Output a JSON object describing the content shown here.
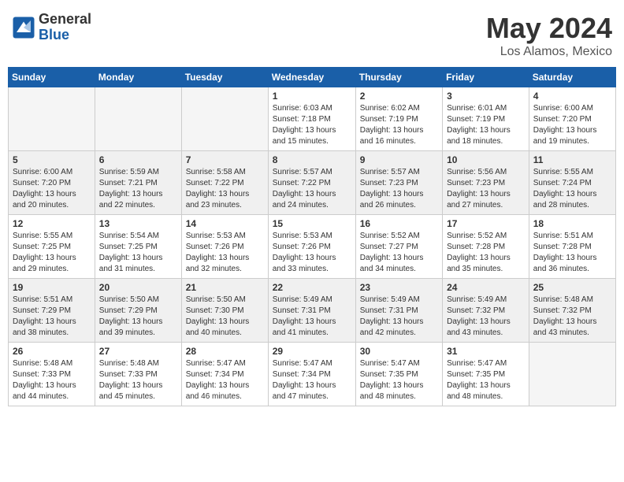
{
  "header": {
    "logo": {
      "general": "General",
      "blue": "Blue"
    },
    "title": "May 2024",
    "location": "Los Alamos, Mexico"
  },
  "weekdays": [
    "Sunday",
    "Monday",
    "Tuesday",
    "Wednesday",
    "Thursday",
    "Friday",
    "Saturday"
  ],
  "weeks": [
    [
      {
        "day": "",
        "sunrise": "",
        "sunset": "",
        "daylight": ""
      },
      {
        "day": "",
        "sunrise": "",
        "sunset": "",
        "daylight": ""
      },
      {
        "day": "",
        "sunrise": "",
        "sunset": "",
        "daylight": ""
      },
      {
        "day": "1",
        "sunrise": "Sunrise: 6:03 AM",
        "sunset": "Sunset: 7:18 PM",
        "daylight": "Daylight: 13 hours and 15 minutes."
      },
      {
        "day": "2",
        "sunrise": "Sunrise: 6:02 AM",
        "sunset": "Sunset: 7:19 PM",
        "daylight": "Daylight: 13 hours and 16 minutes."
      },
      {
        "day": "3",
        "sunrise": "Sunrise: 6:01 AM",
        "sunset": "Sunset: 7:19 PM",
        "daylight": "Daylight: 13 hours and 18 minutes."
      },
      {
        "day": "4",
        "sunrise": "Sunrise: 6:00 AM",
        "sunset": "Sunset: 7:20 PM",
        "daylight": "Daylight: 13 hours and 19 minutes."
      }
    ],
    [
      {
        "day": "5",
        "sunrise": "Sunrise: 6:00 AM",
        "sunset": "Sunset: 7:20 PM",
        "daylight": "Daylight: 13 hours and 20 minutes."
      },
      {
        "day": "6",
        "sunrise": "Sunrise: 5:59 AM",
        "sunset": "Sunset: 7:21 PM",
        "daylight": "Daylight: 13 hours and 22 minutes."
      },
      {
        "day": "7",
        "sunrise": "Sunrise: 5:58 AM",
        "sunset": "Sunset: 7:22 PM",
        "daylight": "Daylight: 13 hours and 23 minutes."
      },
      {
        "day": "8",
        "sunrise": "Sunrise: 5:57 AM",
        "sunset": "Sunset: 7:22 PM",
        "daylight": "Daylight: 13 hours and 24 minutes."
      },
      {
        "day": "9",
        "sunrise": "Sunrise: 5:57 AM",
        "sunset": "Sunset: 7:23 PM",
        "daylight": "Daylight: 13 hours and 26 minutes."
      },
      {
        "day": "10",
        "sunrise": "Sunrise: 5:56 AM",
        "sunset": "Sunset: 7:23 PM",
        "daylight": "Daylight: 13 hours and 27 minutes."
      },
      {
        "day": "11",
        "sunrise": "Sunrise: 5:55 AM",
        "sunset": "Sunset: 7:24 PM",
        "daylight": "Daylight: 13 hours and 28 minutes."
      }
    ],
    [
      {
        "day": "12",
        "sunrise": "Sunrise: 5:55 AM",
        "sunset": "Sunset: 7:25 PM",
        "daylight": "Daylight: 13 hours and 29 minutes."
      },
      {
        "day": "13",
        "sunrise": "Sunrise: 5:54 AM",
        "sunset": "Sunset: 7:25 PM",
        "daylight": "Daylight: 13 hours and 31 minutes."
      },
      {
        "day": "14",
        "sunrise": "Sunrise: 5:53 AM",
        "sunset": "Sunset: 7:26 PM",
        "daylight": "Daylight: 13 hours and 32 minutes."
      },
      {
        "day": "15",
        "sunrise": "Sunrise: 5:53 AM",
        "sunset": "Sunset: 7:26 PM",
        "daylight": "Daylight: 13 hours and 33 minutes."
      },
      {
        "day": "16",
        "sunrise": "Sunrise: 5:52 AM",
        "sunset": "Sunset: 7:27 PM",
        "daylight": "Daylight: 13 hours and 34 minutes."
      },
      {
        "day": "17",
        "sunrise": "Sunrise: 5:52 AM",
        "sunset": "Sunset: 7:28 PM",
        "daylight": "Daylight: 13 hours and 35 minutes."
      },
      {
        "day": "18",
        "sunrise": "Sunrise: 5:51 AM",
        "sunset": "Sunset: 7:28 PM",
        "daylight": "Daylight: 13 hours and 36 minutes."
      }
    ],
    [
      {
        "day": "19",
        "sunrise": "Sunrise: 5:51 AM",
        "sunset": "Sunset: 7:29 PM",
        "daylight": "Daylight: 13 hours and 38 minutes."
      },
      {
        "day": "20",
        "sunrise": "Sunrise: 5:50 AM",
        "sunset": "Sunset: 7:29 PM",
        "daylight": "Daylight: 13 hours and 39 minutes."
      },
      {
        "day": "21",
        "sunrise": "Sunrise: 5:50 AM",
        "sunset": "Sunset: 7:30 PM",
        "daylight": "Daylight: 13 hours and 40 minutes."
      },
      {
        "day": "22",
        "sunrise": "Sunrise: 5:49 AM",
        "sunset": "Sunset: 7:31 PM",
        "daylight": "Daylight: 13 hours and 41 minutes."
      },
      {
        "day": "23",
        "sunrise": "Sunrise: 5:49 AM",
        "sunset": "Sunset: 7:31 PM",
        "daylight": "Daylight: 13 hours and 42 minutes."
      },
      {
        "day": "24",
        "sunrise": "Sunrise: 5:49 AM",
        "sunset": "Sunset: 7:32 PM",
        "daylight": "Daylight: 13 hours and 43 minutes."
      },
      {
        "day": "25",
        "sunrise": "Sunrise: 5:48 AM",
        "sunset": "Sunset: 7:32 PM",
        "daylight": "Daylight: 13 hours and 43 minutes."
      }
    ],
    [
      {
        "day": "26",
        "sunrise": "Sunrise: 5:48 AM",
        "sunset": "Sunset: 7:33 PM",
        "daylight": "Daylight: 13 hours and 44 minutes."
      },
      {
        "day": "27",
        "sunrise": "Sunrise: 5:48 AM",
        "sunset": "Sunset: 7:33 PM",
        "daylight": "Daylight: 13 hours and 45 minutes."
      },
      {
        "day": "28",
        "sunrise": "Sunrise: 5:47 AM",
        "sunset": "Sunset: 7:34 PM",
        "daylight": "Daylight: 13 hours and 46 minutes."
      },
      {
        "day": "29",
        "sunrise": "Sunrise: 5:47 AM",
        "sunset": "Sunset: 7:34 PM",
        "daylight": "Daylight: 13 hours and 47 minutes."
      },
      {
        "day": "30",
        "sunrise": "Sunrise: 5:47 AM",
        "sunset": "Sunset: 7:35 PM",
        "daylight": "Daylight: 13 hours and 48 minutes."
      },
      {
        "day": "31",
        "sunrise": "Sunrise: 5:47 AM",
        "sunset": "Sunset: 7:35 PM",
        "daylight": "Daylight: 13 hours and 48 minutes."
      },
      {
        "day": "",
        "sunrise": "",
        "sunset": "",
        "daylight": ""
      }
    ]
  ]
}
